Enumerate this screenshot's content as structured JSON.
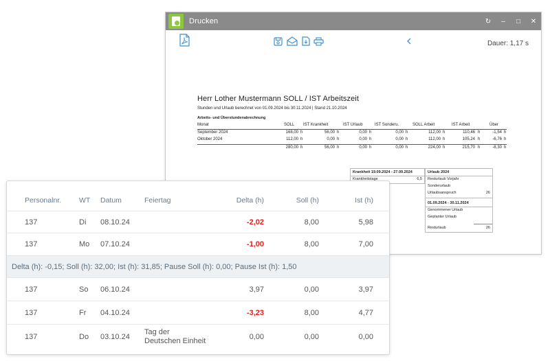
{
  "print_window": {
    "title": "Drucken",
    "duration_label": "Dauer: 1,17 s",
    "controls": {
      "refresh": "↻",
      "minimize": "–",
      "maximize": "□",
      "close": "✕"
    }
  },
  "report": {
    "title": "Herr Lother Mustermann SOLL / IST Arbeitszeit",
    "subtitle": "Stunden und Urlaub berechnet von 01.09.2024 bis 30.11.2024 | Stand 21.10.2024",
    "section": "Arbeits- und Überstundenabrechnung",
    "columns": [
      "Monat",
      "SOLL",
      "IST Krankheit",
      "IST Urlaub",
      "IST Sonderu.",
      "SOLL Arbeit",
      "IST Arbeit",
      "Über"
    ],
    "rows": [
      {
        "monat": "September 2024",
        "soll": "168,00",
        "krank": "56,00",
        "urlaub": "0,00",
        "sonder": "0,00",
        "soll_arbeit": "112,00",
        "ist_arbeit": "110,46",
        "ueber": "-1,54"
      },
      {
        "monat": "Oktober 2024",
        "soll": "112,00",
        "krank": "0,00",
        "urlaub": "0,00",
        "sonder": "0,00",
        "soll_arbeit": "112,00",
        "ist_arbeit": "105,24",
        "ueber": "-6,76"
      }
    ],
    "total": {
      "soll": "280,00",
      "krank": "56,00",
      "urlaub": "0,00",
      "sonder": "0,00",
      "soll_arbeit": "224,00",
      "ist_arbeit": "215,70",
      "ueber": "-8,30"
    },
    "unit": "h",
    "krankheit_box": {
      "header": "Krankheit 19.09.2024 - 27.09.2024",
      "label": "Krankheitstage",
      "value": "6,5"
    },
    "urlaub_box": {
      "header": "Urlaub 2024",
      "lines": [
        {
          "label": "Resturlaub Vorjahr",
          "value": ""
        },
        {
          "label": "Sonderurlaub",
          "value": ""
        },
        {
          "label": "Urlaubsanspruch",
          "value": "26"
        }
      ],
      "period_header": "01.09.2024 - 30.11.2024",
      "period_lines": [
        {
          "label": "Genommener Urlaub",
          "value": ""
        },
        {
          "label": "Geplanter Urlaub",
          "value": ""
        }
      ],
      "rest": {
        "label": "Resturlaub",
        "value": "26"
      }
    }
  },
  "table": {
    "headers": {
      "pnr": "Personalnr.",
      "wt": "WT",
      "datum": "Datum",
      "feiertag": "Feiertag",
      "delta": "Delta (h)",
      "soll": "Soll (h)",
      "ist": "Ist (h)"
    },
    "rows_week1": [
      {
        "pnr": "137",
        "wt": "Di",
        "datum": "08.10.24",
        "feiertag": "",
        "delta": "-2,02",
        "soll": "8,00",
        "ist": "5,98"
      },
      {
        "pnr": "137",
        "wt": "Mo",
        "datum": "07.10.24",
        "feiertag": "",
        "delta": "-1,00",
        "soll": "8,00",
        "ist": "7,00"
      }
    ],
    "summary": "Delta (h): -0,15; Soll (h): 32,00; Ist (h): 31,85; Pause Soll (h): 0,00; Pause Ist (h): 1,50",
    "rows_week2": [
      {
        "pnr": "137",
        "wt": "So",
        "datum": "06.10.24",
        "feiertag": "",
        "delta": "3,97",
        "soll": "0,00",
        "ist": "3,97"
      },
      {
        "pnr": "137",
        "wt": "Fr",
        "datum": "04.10.24",
        "feiertag": "",
        "delta": "-3,23",
        "soll": "8,00",
        "ist": "4,77"
      },
      {
        "pnr": "137",
        "wt": "Do",
        "datum": "03.10.24",
        "feiertag": "Tag der Deutschen Einheit",
        "delta": "0,00",
        "soll": "0,00",
        "ist": "0,00"
      }
    ]
  },
  "colors": {
    "accent": "#3a8fd6",
    "titlebar": "#8a8a8a",
    "logo": "#8dc63f",
    "negative": "#e02020",
    "summary_bg": "#eef1f4"
  }
}
